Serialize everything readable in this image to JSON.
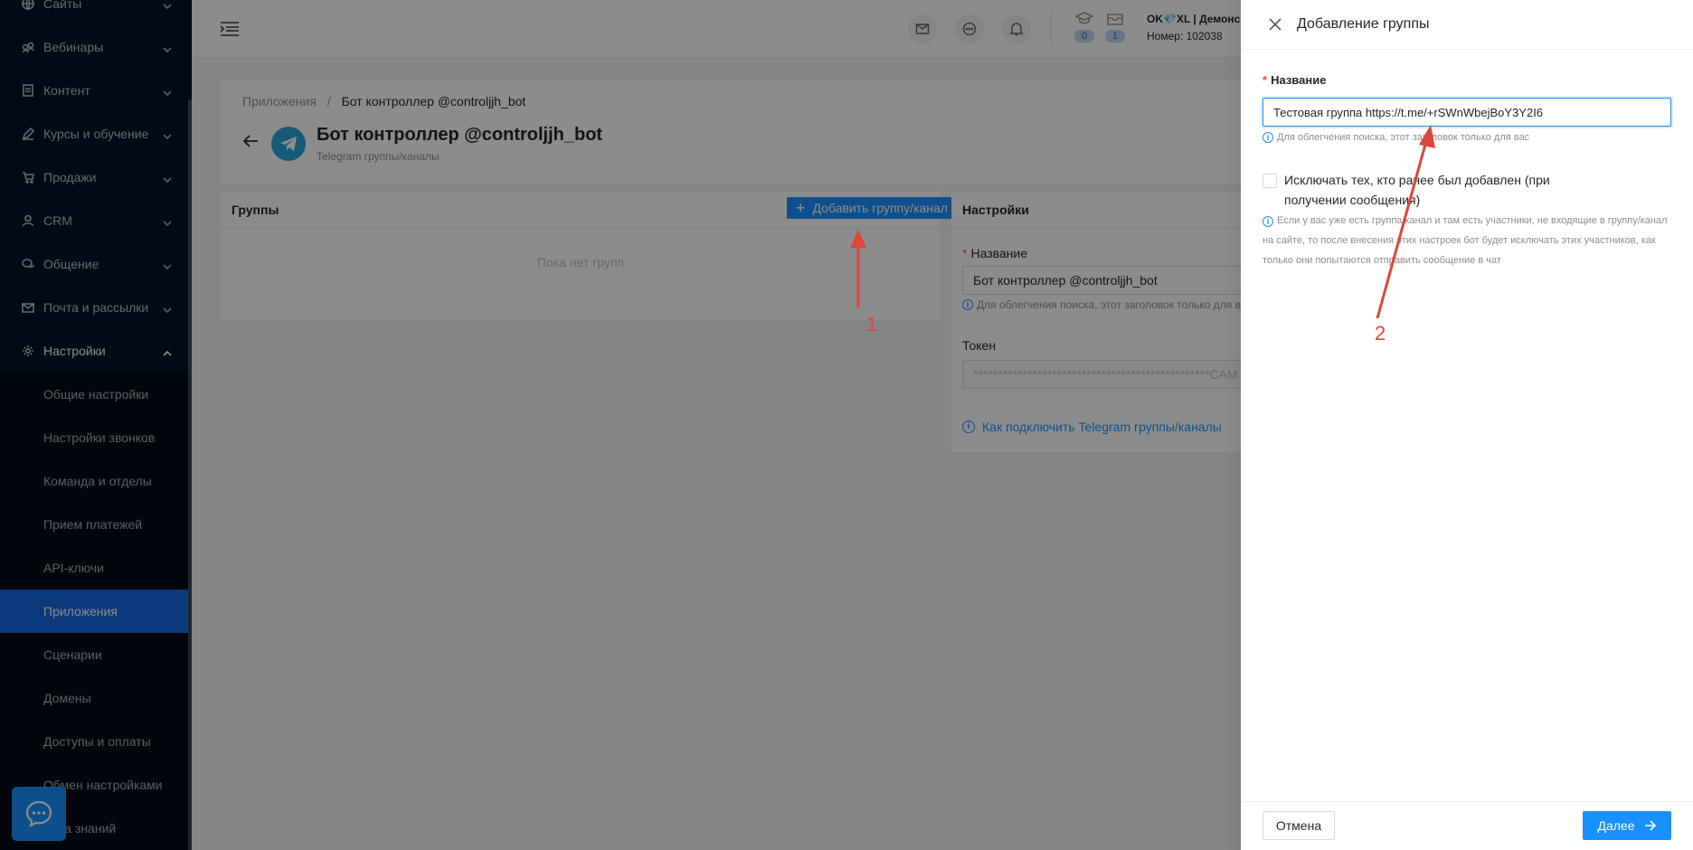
{
  "sidebar": {
    "items": [
      {
        "label": "Сайты",
        "icon": "globe-icon"
      },
      {
        "label": "Вебинары",
        "icon": "webinar-icon"
      },
      {
        "label": "Контент",
        "icon": "content-icon"
      },
      {
        "label": "Курсы и обучение",
        "icon": "edit-icon"
      },
      {
        "label": "Продажи",
        "icon": "cart-icon"
      },
      {
        "label": "CRM",
        "icon": "user-icon"
      },
      {
        "label": "Общение",
        "icon": "chat-icon"
      },
      {
        "label": "Почта и рассылки",
        "icon": "mail-icon"
      },
      {
        "label": "Настройки",
        "icon": "gear-icon"
      }
    ],
    "sub_items": [
      {
        "label": "Общие настройки"
      },
      {
        "label": "Настройки звонков"
      },
      {
        "label": "Команда и отделы"
      },
      {
        "label": "Прием платежей"
      },
      {
        "label": "API-ключи"
      },
      {
        "label": "Приложения",
        "active": true
      },
      {
        "label": "Сценарии"
      },
      {
        "label": "Домены"
      },
      {
        "label": "Доступы и оплаты"
      },
      {
        "label": "Обмен настройками"
      },
      {
        "label": "База знаний"
      }
    ]
  },
  "header": {
    "badges": {
      "courses": "0",
      "orders": "1"
    },
    "account_name": "OK💎XL | Демонс",
    "account_number": "Номер: 102038"
  },
  "page": {
    "breadcrumb_parent": "Приложения",
    "breadcrumb_sep": "/",
    "breadcrumb_current": "Бот контроллер @controljjh_bot",
    "title": "Бот контроллер @controljjh_bot",
    "subtitle": "Telegram группы/каналы"
  },
  "groups_card": {
    "title": "Группы",
    "add_button": "Добавить группу/канал",
    "empty_text": "Пока нет групп"
  },
  "settings_card": {
    "title": "Настройки",
    "name_label": "Название",
    "name_value": "Бот контроллер @controljjh_bot",
    "name_hint": "Для облегчения поиска, этот заголовок только для вас",
    "token_label": "Токен",
    "token_value": "************************************************CAM",
    "help_link": "Как подключить Telegram группы/каналы"
  },
  "drawer": {
    "title": "Добавление группы",
    "name_label": "Название",
    "name_value": "Тестовая группа https://t.me/+rSWnWbejBoY3Y2I6",
    "name_hint": "Для облегчения поиска, этот заголовок только для вас",
    "exclude_label": "Исключать тех, кто ранее был добавлен (при получении сообщения)",
    "exclude_hint": "Если у вас уже есть группа/канал и там есть участники, не входящие в группу/канал на сайте, то после внесения этих настроек бот будет исключать этих участников, как только они попытаются отправить сообщение в чат",
    "cancel_button": "Отмена",
    "next_button": "Далее"
  },
  "annotations": {
    "one": "1",
    "two": "2"
  },
  "colors": {
    "sidebar_bg": "#001529",
    "primary": "#1890ff",
    "active_item": "#1668dc",
    "arrow": "#e0453a"
  }
}
